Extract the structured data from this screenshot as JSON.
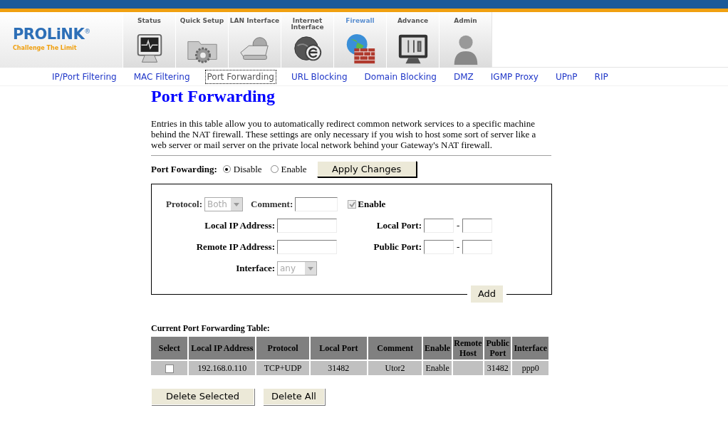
{
  "brand": {
    "name": "PROLiNK",
    "mark": "®",
    "tagline": "Challenge The Limit"
  },
  "tabs": [
    {
      "label": "Status",
      "selected": false
    },
    {
      "label": "Quick Setup",
      "selected": false
    },
    {
      "label": "LAN Interface",
      "selected": false
    },
    {
      "label": "Internet Interface",
      "selected": false
    },
    {
      "label": "Firewall",
      "selected": true
    },
    {
      "label": "Advance",
      "selected": false
    },
    {
      "label": "Admin",
      "selected": false
    }
  ],
  "subnav": [
    {
      "label": "IP/Port Filtering",
      "selected": false
    },
    {
      "label": "MAC Filtering",
      "selected": false
    },
    {
      "label": "Port Forwarding",
      "selected": true
    },
    {
      "label": "URL Blocking",
      "selected": false
    },
    {
      "label": "Domain Blocking",
      "selected": false
    },
    {
      "label": "DMZ",
      "selected": false
    },
    {
      "label": "IGMP Proxy",
      "selected": false
    },
    {
      "label": "UPnP",
      "selected": false
    },
    {
      "label": "RIP",
      "selected": false
    }
  ],
  "page_title": "Port Forwarding",
  "description": "Entries in this table allow you to automatically redirect common network services to a specific machine behind the NAT firewall. These settings are only necessary if you wish to host some sort of server like a web server or mail server on the private local network behind your Gateway's NAT firewall.",
  "port_forwarding": {
    "label": "Port Fowarding:",
    "options": [
      {
        "label": "Disable",
        "selected": true
      },
      {
        "label": "Enable",
        "selected": false
      }
    ],
    "apply_button": "Apply Changes"
  },
  "form": {
    "protocol": {
      "label": "Protocol:",
      "value": "Both",
      "disabled": true
    },
    "comment": {
      "label": "Comment:"
    },
    "enable": {
      "label": "Enable",
      "checked": true,
      "disabled": true
    },
    "local_ip": {
      "label": "Local IP Address:"
    },
    "local_port": {
      "label": "Local Port:",
      "separator": "-"
    },
    "remote_ip": {
      "label": "Remote IP Address:"
    },
    "public_port": {
      "label": "Public Port:",
      "separator": "-"
    },
    "interface": {
      "label": "Interface:",
      "value": "any",
      "disabled": true
    },
    "add_button": "Add"
  },
  "table": {
    "title": "Current Port Forwarding Table:",
    "columns": [
      "Select",
      "Local IP Address",
      "Protocol",
      "Local Port",
      "Comment",
      "Enable",
      "Remote Host",
      "Public Port",
      "Interface"
    ],
    "rows": [
      {
        "checked": false,
        "cells": [
          "",
          "192.168.0.110",
          "TCP+UDP",
          "31482",
          "Utor2",
          "Enable",
          "",
          "31482",
          "ppp0"
        ]
      }
    ]
  },
  "buttons": [
    "Delete Selected",
    "Delete All"
  ]
}
